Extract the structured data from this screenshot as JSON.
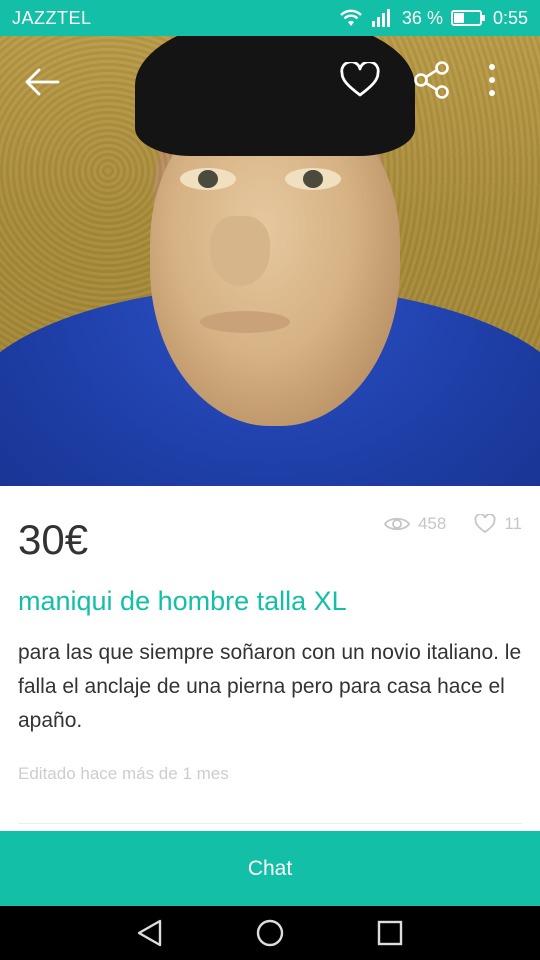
{
  "status_bar": {
    "carrier": "JAZZTEL",
    "battery": "36 %",
    "time": "0:55"
  },
  "header": {
    "icons": [
      "back-arrow-icon",
      "heart-icon",
      "share-icon",
      "more-vert-icon"
    ]
  },
  "gallery": {
    "images_count": 4,
    "active_index": 0
  },
  "listing": {
    "price": "30€",
    "views": "458",
    "favorites": "11",
    "title": "maniqui de hombre talla XL",
    "description": "para las que siempre soñaron con un novio italiano. le falla el anclaje de una pierna pero para casa hace el apaño.",
    "edited": "Editado hace más de 1 mes"
  },
  "actions": {
    "chat_label": "Chat"
  },
  "colors": {
    "accent": "#13bfa6"
  }
}
